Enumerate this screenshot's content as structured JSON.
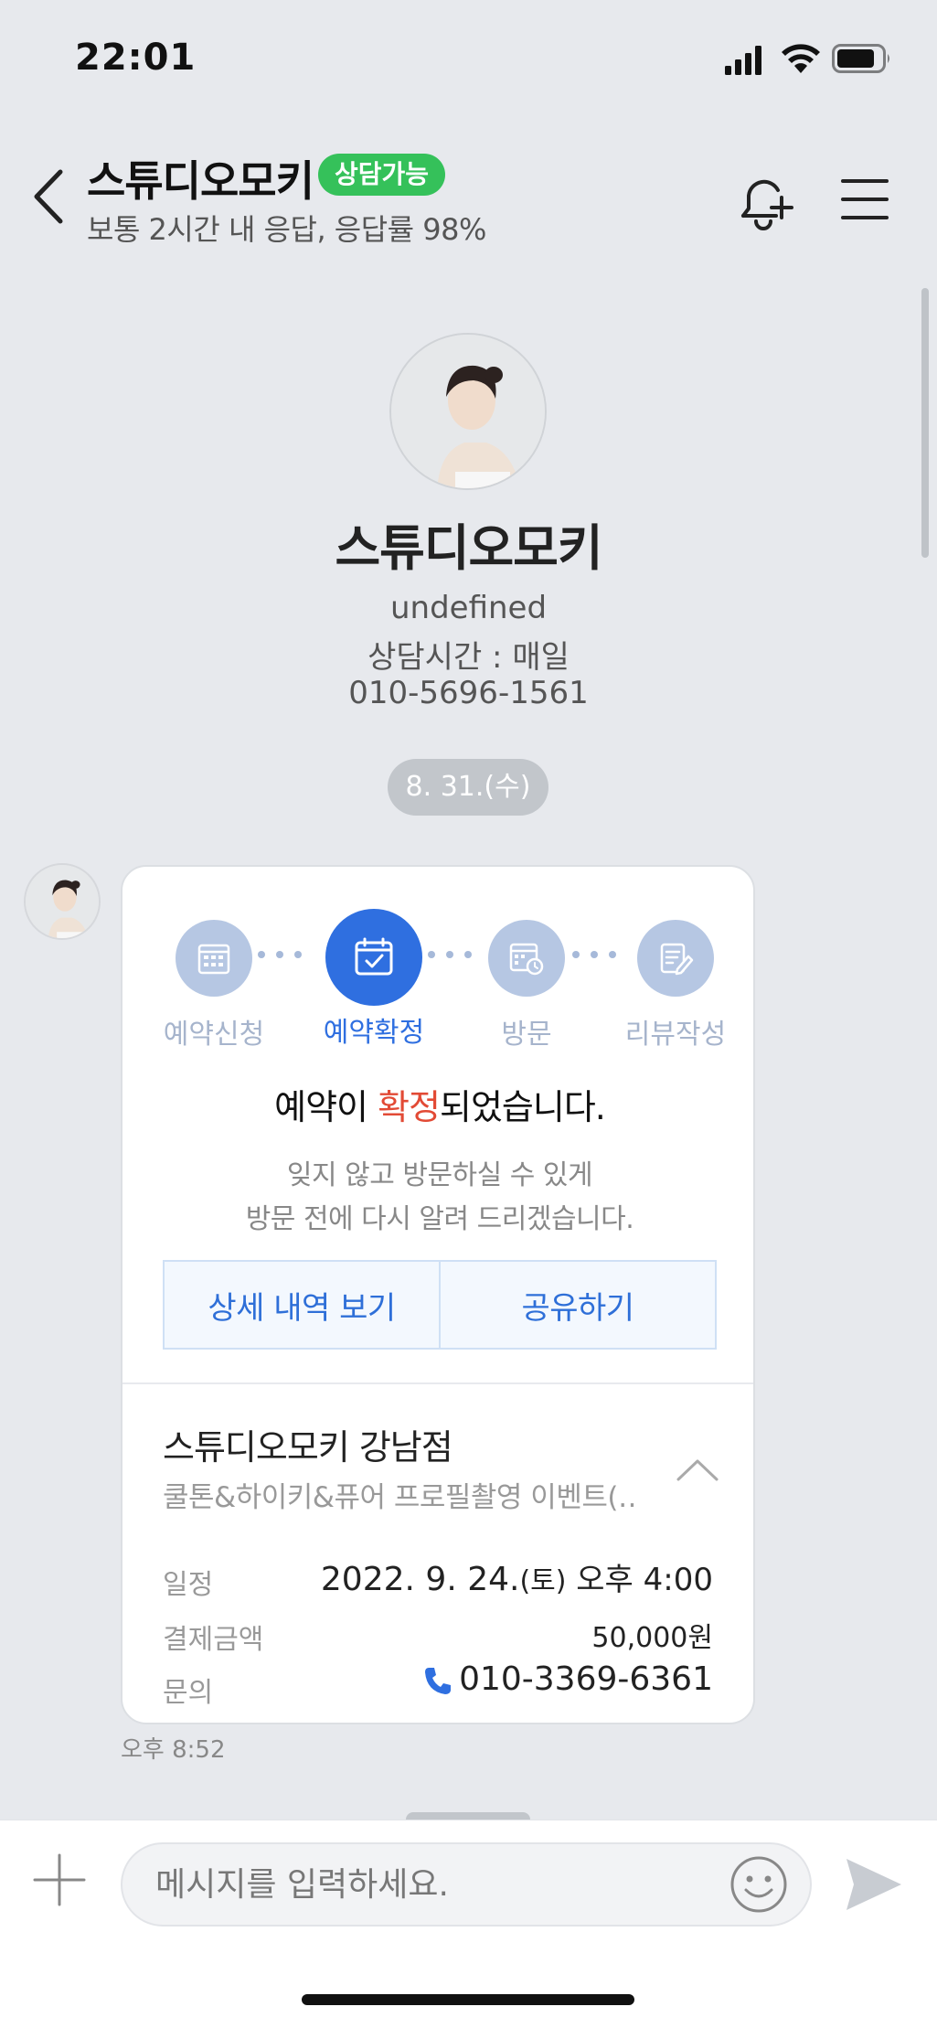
{
  "status_bar": {
    "time": "22:01"
  },
  "header": {
    "title": "스튜디오모키",
    "badge": "상담가능",
    "subtitle": "보통 2시간 내 응답, 응답률 98%"
  },
  "profile": {
    "name": "스튜디오모키",
    "description": "undefined",
    "hours": "상담시간 : 매일",
    "phone": "010-5696-1561"
  },
  "date_divider": "8. 31.(수)",
  "card": {
    "steps": [
      {
        "label": "예약신청",
        "icon": "calendar-grid-icon",
        "active": false
      },
      {
        "label": "예약확정",
        "icon": "calendar-check-icon",
        "active": true
      },
      {
        "label": "방문",
        "icon": "calendar-clock-icon",
        "active": false
      },
      {
        "label": "리뷰작성",
        "icon": "edit-note-icon",
        "active": false
      }
    ],
    "title_prefix": "예약이 ",
    "title_highlight": "확정",
    "title_suffix": "되었습니다.",
    "desc_line1": "잊지 않고 방문하실 수 있게",
    "desc_line2": "방문 전에 다시 알려 드리겠습니다.",
    "detail_button": "상세 내역 보기",
    "share_button": "공유하기",
    "branch": "스튜디오모키 강남점",
    "event": "쿨톤&하이키&퓨어 프로필촬영 이벤트(…",
    "schedule_label": "일정",
    "schedule_date": "2022. 9. 24.",
    "schedule_day": "(토)",
    "schedule_time": " 오후 4:00",
    "payment_label": "결제금액",
    "payment_value": "50,000원",
    "inquiry_label": "문의",
    "inquiry_phone": "010-3369-6361",
    "time": "오후 8:52"
  },
  "input": {
    "placeholder": "메시지를 입력하세요."
  },
  "colors": {
    "accent": "#2f6fe0",
    "badge": "#35c15a",
    "highlight": "#e24a35",
    "step_inactive": "#b6c7e3"
  }
}
